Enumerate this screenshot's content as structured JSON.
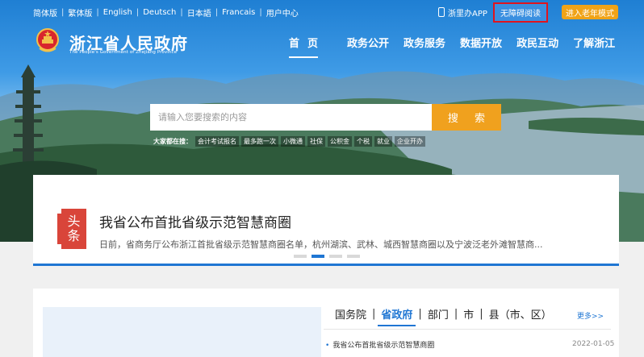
{
  "topbar": {
    "languages": [
      "简体版",
      "繁体版",
      "English",
      "Deutsch",
      "日本語",
      "Francais",
      "用户中心"
    ],
    "app_label": "浙里办APP",
    "accessibility_label": "无障碍阅读",
    "elder_mode_label": "进入老年模式"
  },
  "brand": {
    "title": "浙江省人民政府",
    "subtitle": "The People's Government of Zhejiang Province"
  },
  "nav": {
    "items": [
      "首页",
      "政务公开",
      "政务服务",
      "数据开放",
      "政民互动",
      "了解浙江"
    ],
    "active_index": 0
  },
  "search": {
    "placeholder": "请输入您要搜索的内容",
    "button_label": "搜 索",
    "hot_label": "大家都在搜：",
    "hot_tags": [
      "会计考试报名",
      "最多跑一次",
      "小微通",
      "社保",
      "公积金",
      "个税",
      "就业",
      "企业开办"
    ]
  },
  "headline": {
    "badge_top": "头",
    "badge_bottom": "条",
    "title": "我省公布首批省级示范智慧商圈",
    "summary": "日前，省商务厅公布浙江首批省级示范智慧商圈名单，杭州湖滨、武林、城西智慧商圈以及宁波泛老外滩智慧商...",
    "slides_count": 4,
    "active_slide": 1
  },
  "news": {
    "tabs": [
      "国务院",
      "省政府",
      "部门",
      "市",
      "县（市、区）"
    ],
    "active_tab": 1,
    "more_label": "更多>>",
    "items": [
      {
        "title": "我省公布首批省级示范智慧商圈",
        "date": "2022-01-05"
      }
    ]
  },
  "colors": {
    "accent_blue": "#1f76d3",
    "search_orange": "#f0a11e",
    "badge_red": "#d9453a",
    "highlight_red": "#e0141e"
  }
}
